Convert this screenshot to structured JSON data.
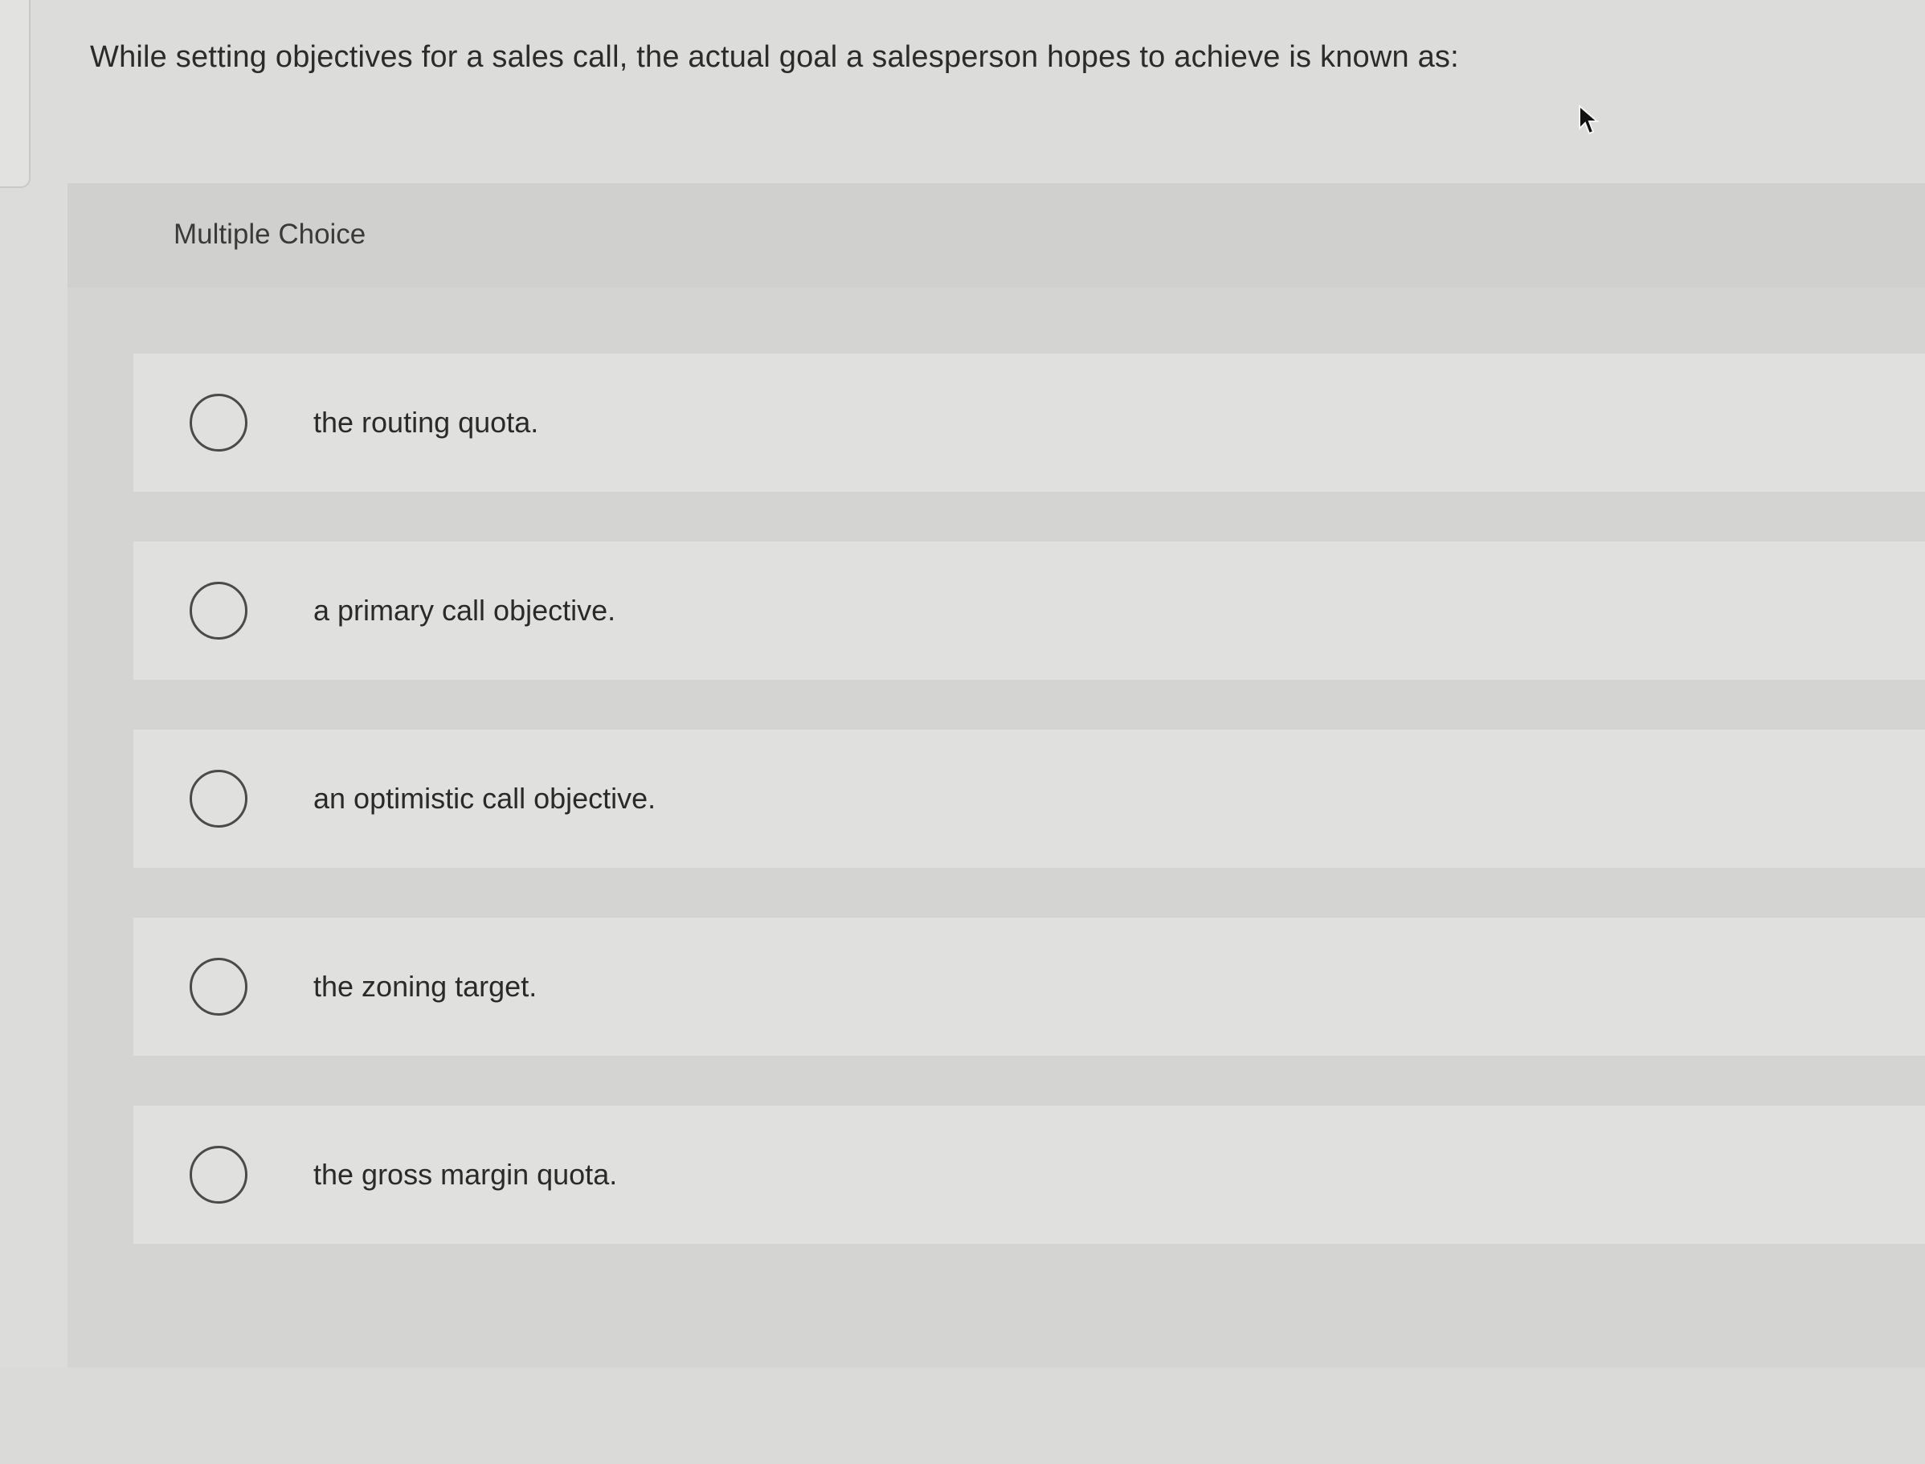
{
  "question": {
    "text": "While setting objectives for a sales call, the actual goal a salesperson hopes to achieve is known as:"
  },
  "panel": {
    "type_label": "Multiple Choice"
  },
  "options": [
    {
      "label": "the routing quota.",
      "selected": false
    },
    {
      "label": "a primary call objective.",
      "selected": false
    },
    {
      "label": "an optimistic call objective.",
      "selected": false
    },
    {
      "label": "the zoning target.",
      "selected": false
    },
    {
      "label": "the gross margin quota.",
      "selected": false
    }
  ],
  "icons": {
    "cursor": "mouse-pointer-icon",
    "radio": "radio-button-icon"
  }
}
